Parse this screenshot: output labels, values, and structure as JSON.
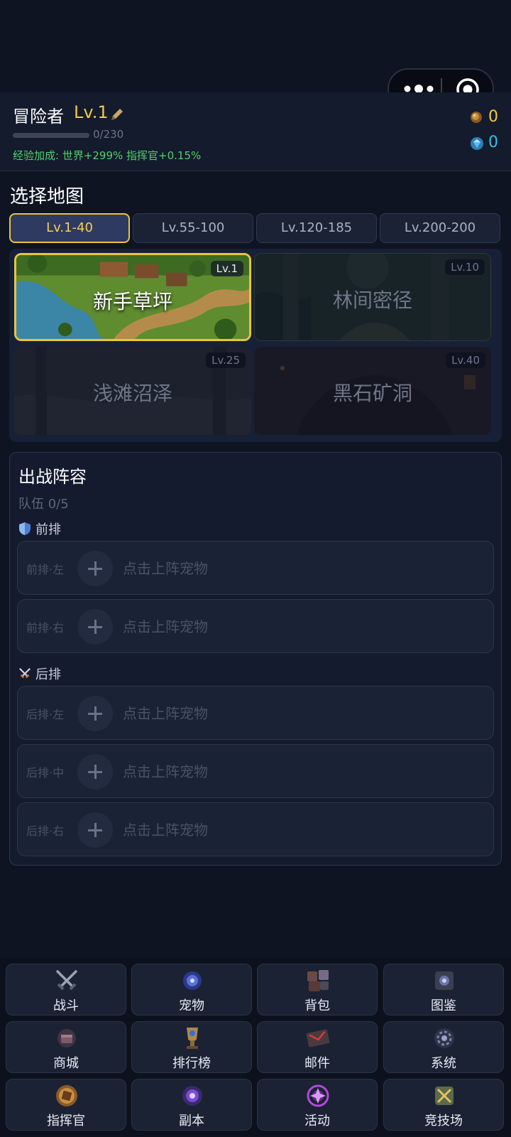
{
  "header": {
    "name": "冒险者",
    "level": "Lv.1",
    "xp_text": "0/230",
    "xp_progress": 0,
    "bonus_text": "经验加成: 世界+299% 指挥官+0.15%",
    "gold": "0",
    "gems": "0"
  },
  "map_section": {
    "title": "选择地图",
    "tabs": [
      {
        "label": "Lv.1-40",
        "active": true
      },
      {
        "label": "Lv.55-100",
        "active": false
      },
      {
        "label": "Lv.120-185",
        "active": false
      },
      {
        "label": "Lv.200-200",
        "active": false
      }
    ],
    "maps": [
      {
        "name": "新手草坪",
        "level": "Lv.1",
        "active": true
      },
      {
        "name": "林间密径",
        "level": "Lv.10",
        "active": false
      },
      {
        "name": "浅滩沼泽",
        "level": "Lv.25",
        "active": false
      },
      {
        "name": "黑石矿洞",
        "level": "Lv.40",
        "active": false
      }
    ]
  },
  "lineup": {
    "title": "出战阵容",
    "team_count": "队伍 0/5",
    "front_label": "前排",
    "back_label": "后排",
    "slots": [
      {
        "position": "前排·左",
        "hint": "点击上阵宠物"
      },
      {
        "position": "前排·右",
        "hint": "点击上阵宠物"
      },
      {
        "position": "后排·左",
        "hint": "点击上阵宠物"
      },
      {
        "position": "后排·中",
        "hint": "点击上阵宠物"
      },
      {
        "position": "后排·右",
        "hint": "点击上阵宠物"
      }
    ]
  },
  "nav": [
    {
      "label": "战斗",
      "icon": "crossed-swords-icon"
    },
    {
      "label": "宠物",
      "icon": "pet-orb-icon"
    },
    {
      "label": "背包",
      "icon": "backpack-icon"
    },
    {
      "label": "图鉴",
      "icon": "codex-book-icon"
    },
    {
      "label": "商城",
      "icon": "shop-chest-icon"
    },
    {
      "label": "排行榜",
      "icon": "trophy-icon"
    },
    {
      "label": "邮件",
      "icon": "mail-icon"
    },
    {
      "label": "系统",
      "icon": "gear-icon"
    },
    {
      "label": "指挥官",
      "icon": "commander-emblem-icon"
    },
    {
      "label": "副本",
      "icon": "portal-icon"
    },
    {
      "label": "活动",
      "icon": "event-sigil-icon"
    },
    {
      "label": "竞技场",
      "icon": "arena-shield-icon"
    }
  ],
  "colors": {
    "accent_gold": "#f3c94b",
    "bonus_green": "#4fd16a",
    "gem_blue": "#37c0e6",
    "background": "#0f1423"
  }
}
